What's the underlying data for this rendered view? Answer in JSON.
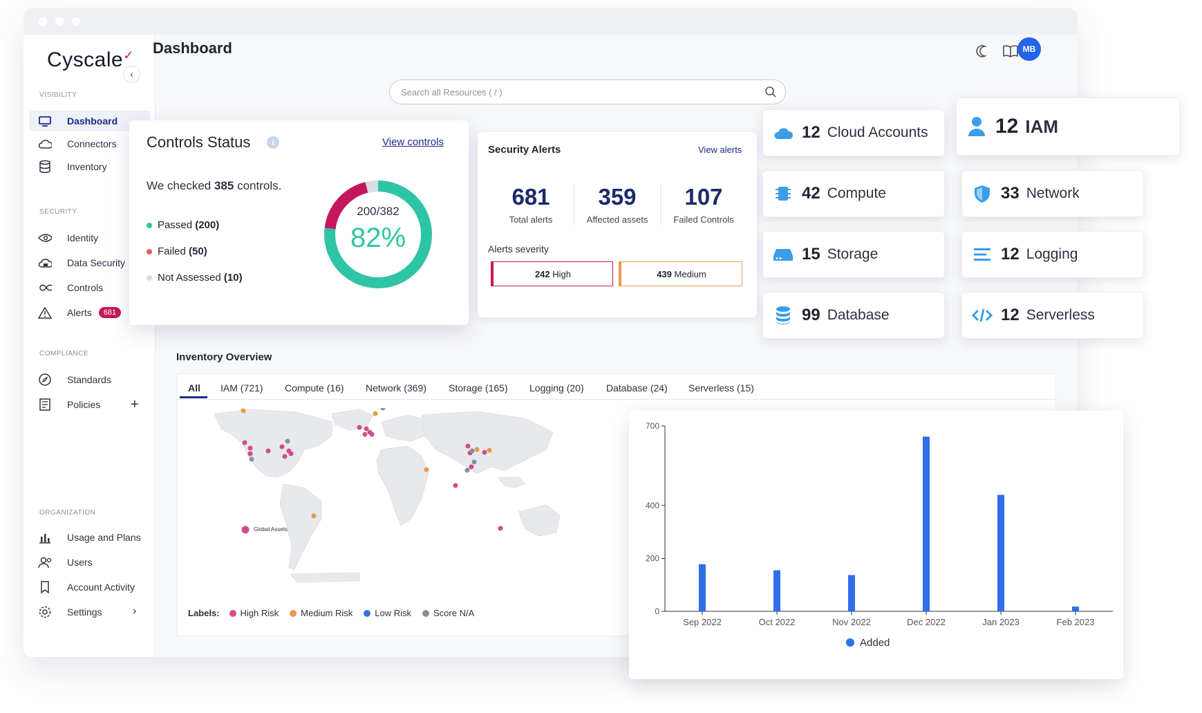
{
  "app": {
    "logo": "Cyscale",
    "page_title": "Dashboard",
    "avatar_initials": "MB"
  },
  "search": {
    "placeholder": "Search all Resources ( / )"
  },
  "sidebar": {
    "sections": [
      {
        "label": "VISIBILITY",
        "items": [
          {
            "label": "Dashboard",
            "icon": "monitor-icon",
            "active": true
          },
          {
            "label": "Connectors",
            "icon": "cloud-icon"
          },
          {
            "label": "Inventory",
            "icon": "database-icon"
          }
        ]
      },
      {
        "label": "SECURITY",
        "items": [
          {
            "label": "Identity",
            "icon": "eye-icon"
          },
          {
            "label": "Data Security",
            "icon": "cloud-lock-icon"
          },
          {
            "label": "Controls",
            "icon": "infinity-icon"
          },
          {
            "label": "Alerts",
            "icon": "warning-icon",
            "badge": "681"
          }
        ]
      },
      {
        "label": "COMPLIANCE",
        "items": [
          {
            "label": "Standards",
            "icon": "compass-icon"
          },
          {
            "label": "Policies",
            "icon": "document-icon"
          }
        ]
      },
      {
        "label": "ORGANIZATION",
        "items": [
          {
            "label": "Usage and Plans",
            "icon": "bar-chart-icon"
          },
          {
            "label": "Users",
            "icon": "users-icon"
          },
          {
            "label": "Account Activity",
            "icon": "bookmark-icon"
          },
          {
            "label": "Settings",
            "icon": "gear-icon"
          }
        ]
      }
    ]
  },
  "controls_status": {
    "title": "Controls Status",
    "link": "View controls",
    "summary_prefix": "We checked",
    "summary_count": "385",
    "summary_suffix": "controls.",
    "passed_label": "Passed",
    "passed_count": "(200)",
    "failed_label": "Failed",
    "failed_count": "(50)",
    "not_assessed_label": "Not Assessed",
    "not_assessed_count": "(10)",
    "ratio": "200/382",
    "percent": "82%",
    "donut": {
      "passed": 200,
      "failed": 50,
      "not_assessed": 10
    },
    "colors": {
      "passed": "#2ec4a6",
      "failed": "#c2185b",
      "not_assessed": "#d9dce1"
    }
  },
  "security_alerts": {
    "title": "Security Alerts",
    "link": "View alerts",
    "stats": [
      {
        "value": "681",
        "label": "Total alerts"
      },
      {
        "value": "359",
        "label": "Affected assets"
      },
      {
        "value": "107",
        "label": "Failed Controls"
      }
    ],
    "severity_label": "Alerts severity",
    "high_count": "242",
    "high_label": "High",
    "medium_count": "439",
    "medium_label": "Medium"
  },
  "tiles": [
    {
      "num": "12",
      "label": "Cloud Accounts",
      "icon": "cloud-icon"
    },
    {
      "num": "12",
      "label": "IAM",
      "icon": "user-icon"
    },
    {
      "num": "42",
      "label": "Compute",
      "icon": "chip-icon"
    },
    {
      "num": "33",
      "label": "Network",
      "icon": "shield-icon"
    },
    {
      "num": "15",
      "label": "Storage",
      "icon": "storage-icon"
    },
    {
      "num": "12",
      "label": "Logging",
      "icon": "lines-icon"
    },
    {
      "num": "99",
      "label": "Database",
      "icon": "database-icon"
    },
    {
      "num": "12",
      "label": "Serverless",
      "icon": "code-icon"
    }
  ],
  "inventory": {
    "title": "Inventory Overview",
    "tabs": [
      "All",
      "IAM (721)",
      "Compute (16)",
      "Network (369)",
      "Storage (165)",
      "Logging (20)",
      "Database (24)",
      "Serverless (15)"
    ],
    "global_assets_label": "Global Assets",
    "legend": {
      "title": "Labels:",
      "items": [
        "High Risk",
        "Medium Risk",
        "Low Risk",
        "Score N/A"
      ]
    },
    "legend_colors": [
      "#d14b8f",
      "#e69a4d",
      "#3b6fe0",
      "#8a8f99"
    ]
  },
  "chart_data": {
    "type": "bar",
    "categories": [
      "Sep 2022",
      "Oct 2022",
      "Nov 2022",
      "Dec 2022",
      "Jan 2023",
      "Feb 2023"
    ],
    "series": [
      {
        "name": "Added",
        "values": [
          178,
          155,
          137,
          660,
          440,
          18
        ]
      }
    ],
    "ylim": [
      0,
      700
    ],
    "yticks": [
      0,
      200,
      400,
      700
    ],
    "legend_position": "bottom",
    "color": "#2f6fea"
  }
}
